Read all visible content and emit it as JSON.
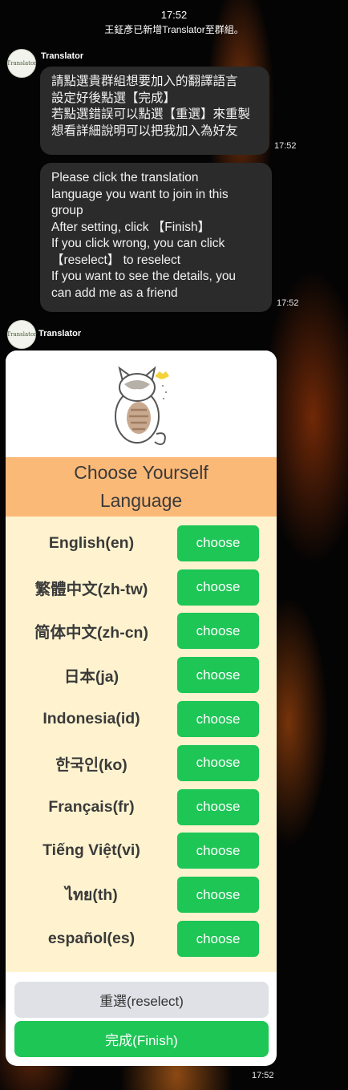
{
  "status": {
    "time": "17:52",
    "system_message": "王鉦彥已新增Translator至群組。"
  },
  "messages": [
    {
      "sender": "Translator",
      "lines": [
        "請點選貴群組想要加入的翻譯語言",
        "設定好後點選【完成】",
        "若點選錯誤可以點選【重選】來重製",
        "想看詳細說明可以把我加入為好友"
      ],
      "time": "17:52"
    },
    {
      "lines": [
        "Please click the translation",
        "language you want to join in this",
        "group",
        "After setting, click 【Finish】",
        "If you click wrong, you can click",
        "【reselect】 to reselect",
        "If you want to see the details, you",
        "can add me as a friend"
      ],
      "time": "17:52"
    }
  ],
  "card": {
    "sender": "Translator",
    "avatar_text": "Translator",
    "hero_icon": "cat-illustration-icon",
    "header_line1": "Choose Yourself",
    "header_line2": "Language",
    "choose_label": "choose",
    "languages": [
      {
        "label": "English(en)"
      },
      {
        "label": "繁體中文(zh-tw)"
      },
      {
        "label": "简体中文(zh-cn)"
      },
      {
        "label": "日本(ja)"
      },
      {
        "label": "Indonesia(id)"
      },
      {
        "label": "한국인(ko)"
      },
      {
        "label": "Français(fr)"
      },
      {
        "label": "Tiếng Việt(vi)"
      },
      {
        "label": "ไทย(th)"
      },
      {
        "label": "español(es)"
      }
    ],
    "reselect_label": "重選(reselect)",
    "finish_label": "完成(Finish)",
    "time": "17:52"
  },
  "colors": {
    "header_band": "#fbb978",
    "lang_area": "#fff3cf",
    "choose_button": "#1ec656",
    "reselect_button": "#dfe1e6",
    "bubble": "#2b2b2b"
  }
}
